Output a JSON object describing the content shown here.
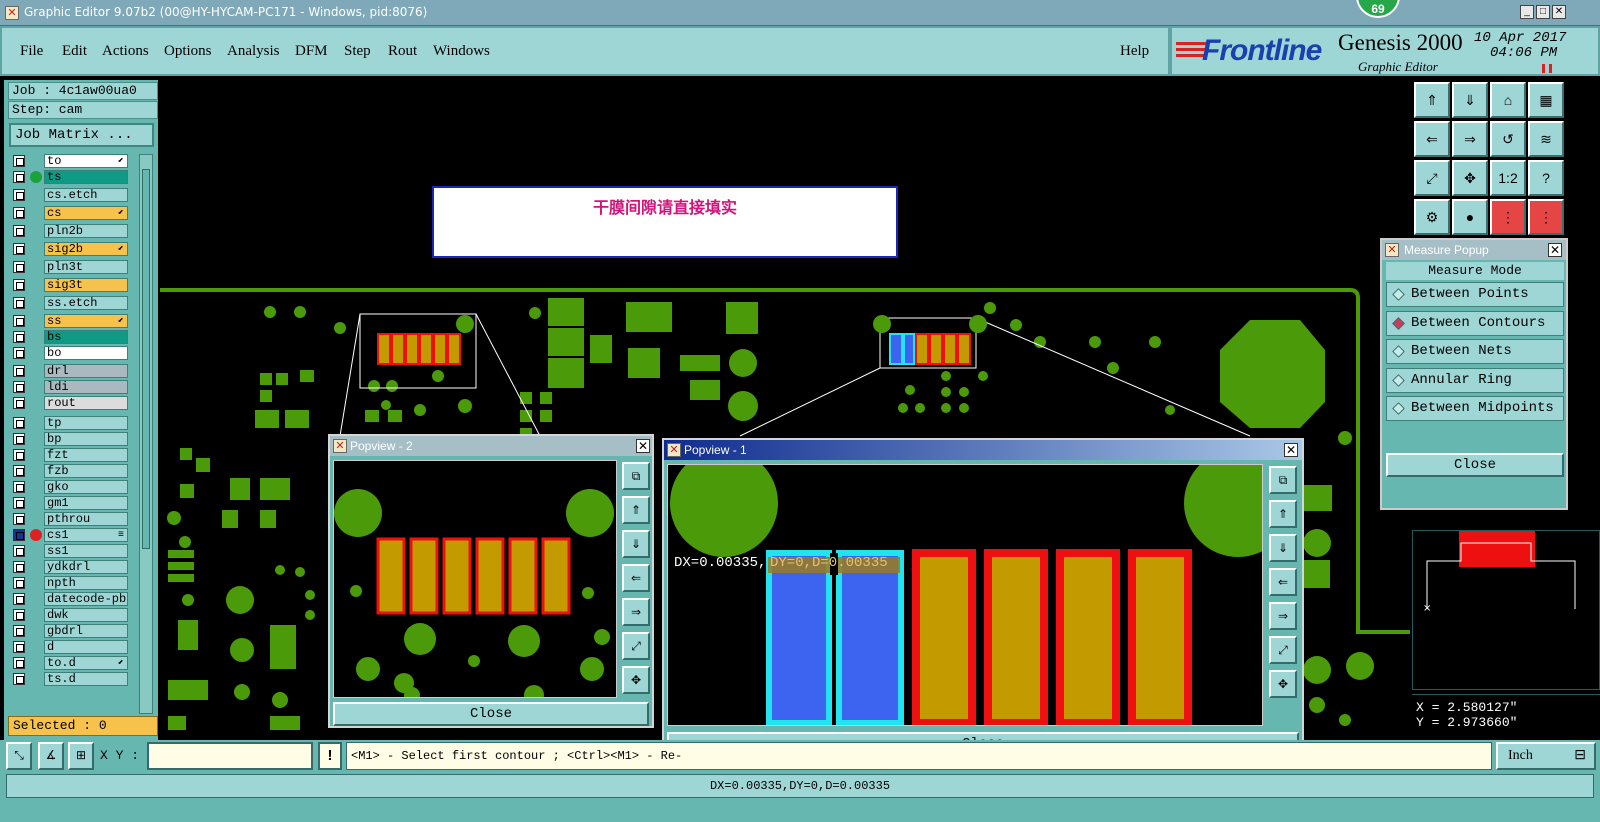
{
  "window": {
    "title": "Graphic Editor 9.07b2 (00@HY-HYCAM-PC171 - Windows, pid:8076)",
    "badge": "69"
  },
  "menu": {
    "items": [
      "File",
      "Edit",
      "Actions",
      "Options",
      "Analysis",
      "DFM",
      "Step",
      "Rout",
      "Windows"
    ],
    "help": "Help"
  },
  "brand": {
    "logo": "Frontline",
    "product": "Genesis 2000",
    "subtitle": "Graphic Editor",
    "date": "10 Apr 2017",
    "time": "04:06 PM"
  },
  "job": {
    "job_label": "Job : 4c1aw00ua0",
    "step_label": "Step: cam",
    "job_matrix": "Job Matrix ..."
  },
  "layers": [
    {
      "name": "to",
      "color": "#ffffff",
      "mark": "⬋"
    },
    {
      "name": "ts",
      "color": "#0f9a86",
      "dot": "#1aa33a"
    },
    {
      "name": "cs.etch",
      "color": "#9ed6d6"
    },
    {
      "name": "cs",
      "color": "#f6c24c",
      "mark": "⬋"
    },
    {
      "name": "pln2b",
      "color": "#9ed6d6"
    },
    {
      "name": "sig2b",
      "color": "#f6c24c",
      "mark": "⬋"
    },
    {
      "name": "pln3t",
      "color": "#9ed6d6"
    },
    {
      "name": "sig3t",
      "color": "#f6c24c"
    },
    {
      "name": "ss.etch",
      "color": "#9ed6d6"
    },
    {
      "name": "ss",
      "color": "#f6c24c",
      "mark": "⬋"
    },
    {
      "name": "bs",
      "color": "#0f9a86"
    },
    {
      "name": "bo",
      "color": "#ffffff"
    },
    {
      "name": "drl",
      "color": "#a9b9bf"
    },
    {
      "name": "ldi",
      "color": "#a9b9bf"
    },
    {
      "name": "rout",
      "color": "#dcdcdc"
    },
    {
      "name": "tp",
      "color": "#9ed6d6"
    },
    {
      "name": "bp",
      "color": "#9ed6d6"
    },
    {
      "name": "fzt",
      "color": "#9ed6d6"
    },
    {
      "name": "fzb",
      "color": "#9ed6d6"
    },
    {
      "name": "gko",
      "color": "#9ed6d6"
    },
    {
      "name": "gm1",
      "color": "#9ed6d6"
    },
    {
      "name": "pthrou",
      "color": "#9ed6d6"
    },
    {
      "name": "cs1",
      "color": "#9ed6d6",
      "dot": "#e02020",
      "mark": "≡",
      "active": true
    },
    {
      "name": "ss1",
      "color": "#9ed6d6"
    },
    {
      "name": "ydkdrl",
      "color": "#9ed6d6"
    },
    {
      "name": "npth",
      "color": "#9ed6d6"
    },
    {
      "name": "datecode-pbe",
      "color": "#9ed6d6"
    },
    {
      "name": "dwk",
      "color": "#9ed6d6"
    },
    {
      "name": "gbdrl",
      "color": "#9ed6d6"
    },
    {
      "name": "d",
      "color": "#9ed6d6"
    },
    {
      "name": "to.d",
      "color": "#9ed6d6",
      "mark": "⬋"
    },
    {
      "name": "ts.d",
      "color": "#9ed6d6"
    }
  ],
  "selected_label": "Selected : 0",
  "note_text": "干膜间隙请直接填实",
  "measure": {
    "title": "Measure Popup",
    "mode_label": "Measure Mode",
    "options": [
      "Between Points",
      "Between Contours",
      "Between Nets",
      "Annular Ring",
      "Between Midpoints"
    ],
    "selected": "Between Contours",
    "close": "Close"
  },
  "coords": {
    "x": "X = 2.580127\"",
    "y": "Y = 2.973660\""
  },
  "popview2": {
    "title": "Popview - 2",
    "close": "Close"
  },
  "popview1": {
    "title": "Popview - 1",
    "close": "Close",
    "dx_label": "DX=0.00335,",
    "dy_label": "DY=0,D=0.00335"
  },
  "command": {
    "xy_label": "X Y :",
    "prompt": "<M1> - Select first contour ; <Ctrl><M1> - Re-",
    "unit": "Inch",
    "excl": "!"
  },
  "status_text": "DX=0.00335,DY=0,D=0.00335",
  "colors": {
    "pad_green": "#4a9a0a",
    "panel": "#66b7b0",
    "button": "#9ed6d6",
    "accent_orange": "#f6c24c",
    "pad_red": "#ee1010",
    "pad_fill": "#c39a00",
    "cyan": "#22e3f0",
    "blue": "#3c64f0"
  }
}
